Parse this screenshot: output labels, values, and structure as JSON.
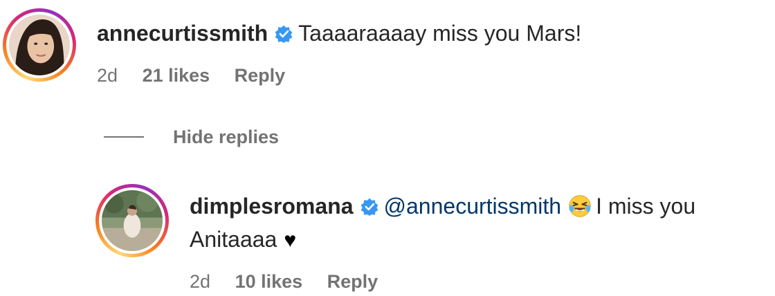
{
  "comment": {
    "username": "annecurtissmith",
    "text": "Taaaaraaaay miss you Mars!",
    "time": "2d",
    "likes": "21 likes",
    "reply_label": "Reply"
  },
  "hide_replies_label": "Hide replies",
  "reply": {
    "username": "dimplesromana",
    "mention": "@annecurtissmith",
    "text_part1": "I miss you",
    "text_part2": "Anitaaaa",
    "heart": "♥",
    "time": "2d",
    "likes": "10 likes",
    "reply_label": "Reply"
  },
  "colors": {
    "verified": "#3897f0",
    "mention": "#00376b",
    "secondary": "#737373"
  }
}
